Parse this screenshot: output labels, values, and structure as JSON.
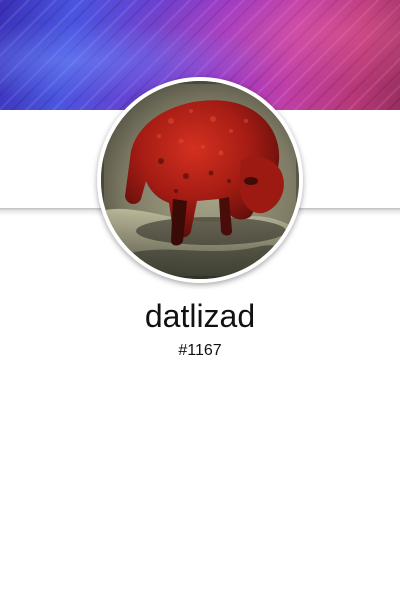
{
  "profile": {
    "username": "datlizad",
    "discriminator": "#1167"
  },
  "banner": {
    "style": "purple-blue-magenta streaked gradient"
  },
  "avatar": {
    "icon": "profile-photo-red-animal"
  },
  "colors": {
    "background": "#ffffff",
    "text": "#111111",
    "banner_start": "#3a2fb8",
    "banner_end": "#9a2e60",
    "avatar_subject": "#b0221a"
  }
}
